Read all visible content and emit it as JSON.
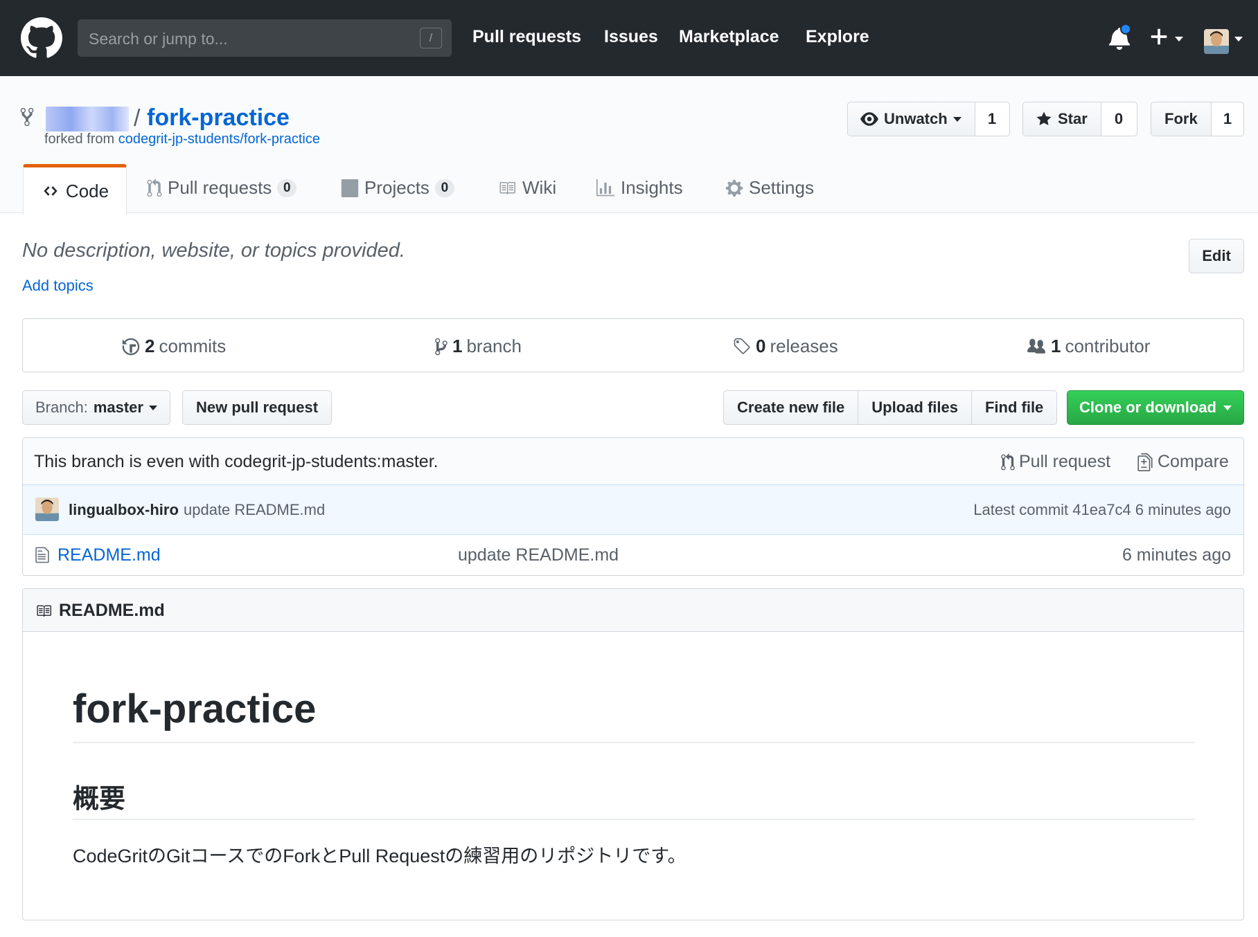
{
  "header": {
    "search_placeholder": "Search or jump to...",
    "search_key": "/",
    "nav": [
      "Pull requests",
      "Issues",
      "Marketplace",
      "Explore"
    ],
    "plus": "+"
  },
  "repo": {
    "separator": "/",
    "name": "fork-practice",
    "forked_from_label": "forked from",
    "forked_from": "codegrit-jp-students/fork-practice",
    "watch": {
      "label": "Unwatch",
      "count": "1"
    },
    "star": {
      "label": "Star",
      "count": "0"
    },
    "fork": {
      "label": "Fork",
      "count": "1"
    }
  },
  "tabs": [
    {
      "label": "Code",
      "icon": "code-icon"
    },
    {
      "label": "Pull requests",
      "count": "0",
      "icon": "pull-request-icon"
    },
    {
      "label": "Projects",
      "count": "0",
      "icon": "project-icon"
    },
    {
      "label": "Wiki",
      "icon": "book-icon"
    },
    {
      "label": "Insights",
      "icon": "graph-icon"
    },
    {
      "label": "Settings",
      "icon": "gear-icon"
    }
  ],
  "about": {
    "description": "No description, website, or topics provided.",
    "add_topics": "Add topics",
    "edit": "Edit"
  },
  "summary": {
    "commits": {
      "num": "2",
      "label": "commits"
    },
    "branches": {
      "num": "1",
      "label": "branch"
    },
    "releases": {
      "num": "0",
      "label": "releases"
    },
    "contributors": {
      "num": "1",
      "label": "contributor"
    }
  },
  "file_nav": {
    "branch_label": "Branch:",
    "branch_value": "master",
    "new_pull_request": "New pull request",
    "create_new_file": "Create new file",
    "upload_files": "Upload files",
    "find_file": "Find file",
    "clone_or_download": "Clone or download"
  },
  "branch_info": {
    "text": "This branch is even with codegrit-jp-students:master.",
    "pull_request": "Pull request",
    "compare": "Compare"
  },
  "commit": {
    "author": "lingualbox-hiro",
    "message": "update README.md",
    "latest": "Latest commit 41ea7c4 6 minutes ago"
  },
  "files": [
    {
      "name": "README.md",
      "message": "update README.md",
      "age": "6 minutes ago"
    }
  ],
  "readme": {
    "title": "README.md",
    "h1": "fork-practice",
    "h2": "概要",
    "p": "CodeGritのGitコースでのForkとPull Requestの練習用のリポジトリです。"
  },
  "colors": {
    "header_bg": "#24292e",
    "link": "#0366d6",
    "selected_tab_border": "#e36209",
    "clone_button": "#28a745",
    "notification_dot": "#2188ff"
  }
}
